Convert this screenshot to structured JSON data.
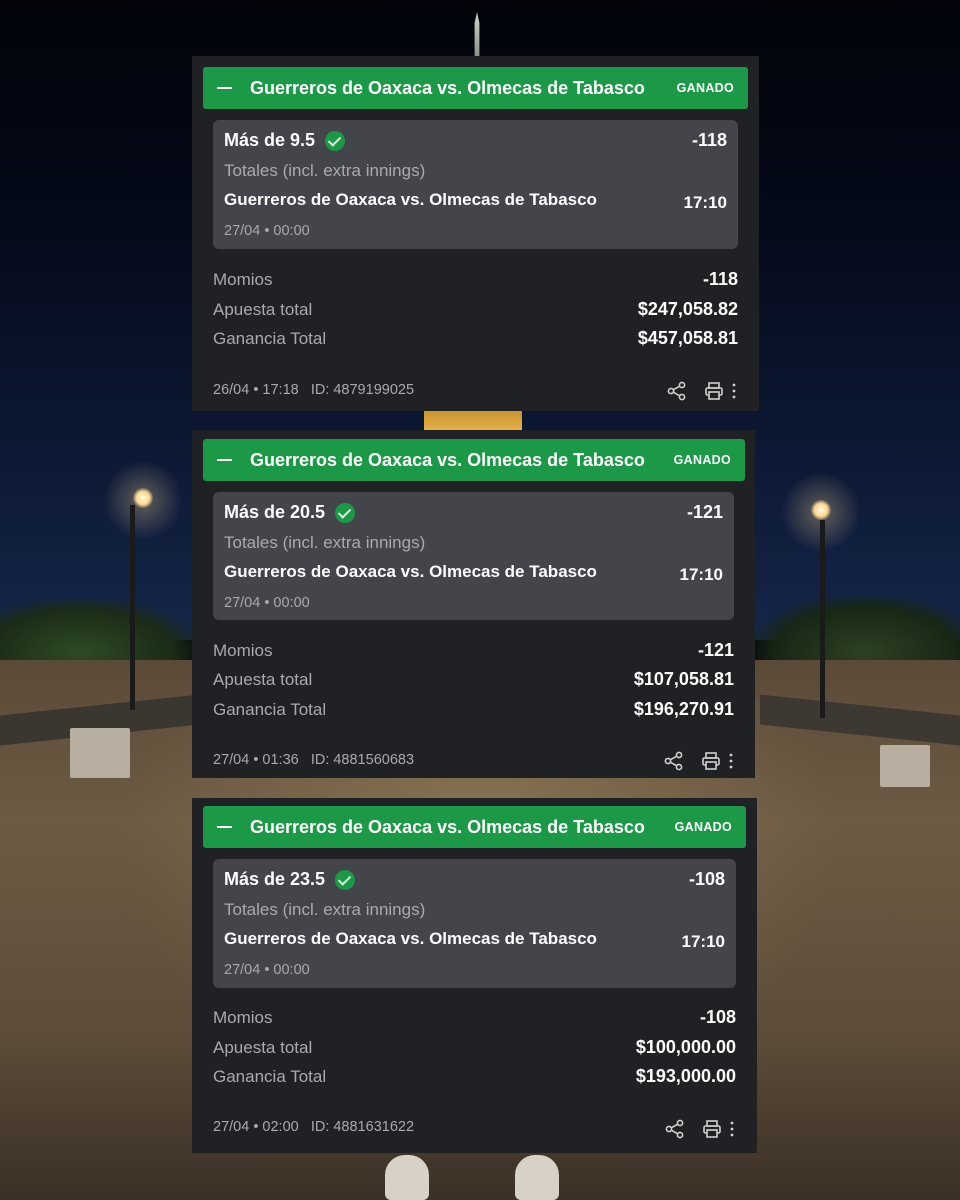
{
  "bets": [
    {
      "header_title": "Guerreros de Oaxaca vs. Olmecas de Tabasco",
      "status": "GANADO",
      "selection": "Más de 9.5",
      "selection_odds": "-118",
      "market": "Totales (incl. extra innings)",
      "event": "Guerreros de Oaxaca vs. Olmecas de Tabasco",
      "event_time": "17:10",
      "event_date": "27/04 • 00:00",
      "momios_label": "Momios",
      "momios_value": "-118",
      "stake_label": "Apuesta total",
      "stake_value": "$247,058.82",
      "payout_label": "Ganancia Total",
      "payout_value": "$457,058.81",
      "placed_at": "26/04 • 17:18",
      "bet_id": "ID: 4879199025"
    },
    {
      "header_title": "Guerreros de Oaxaca vs. Olmecas de Tabasco",
      "status": "GANADO",
      "selection": "Más de 20.5",
      "selection_odds": "-121",
      "market": "Totales (incl. extra innings)",
      "event": "Guerreros de Oaxaca vs. Olmecas de Tabasco",
      "event_time": "17:10",
      "event_date": "27/04 • 00:00",
      "momios_label": "Momios",
      "momios_value": "-121",
      "stake_label": "Apuesta total",
      "stake_value": "$107,058.81",
      "payout_label": "Ganancia Total",
      "payout_value": "$196,270.91",
      "placed_at": "27/04 • 01:36",
      "bet_id": "ID: 4881560683"
    },
    {
      "header_title": "Guerreros de Oaxaca vs. Olmecas de Tabasco",
      "status": "GANADO",
      "selection": "Más de 23.5",
      "selection_odds": "-108",
      "market": "Totales (incl. extra innings)",
      "event": "Guerreros de Oaxaca vs. Olmecas de Tabasco",
      "event_time": "17:10",
      "event_date": "27/04 • 00:00",
      "momios_label": "Momios",
      "momios_value": "-108",
      "stake_label": "Apuesta total",
      "stake_value": "$100,000.00",
      "payout_label": "Ganancia Total",
      "payout_value": "$193,000.00",
      "placed_at": "27/04 • 02:00",
      "bet_id": "ID: 4881631622"
    }
  ],
  "icons": {
    "collapse": "minus-icon",
    "won": "check-circle-icon",
    "share": "share-icon",
    "print": "printer-icon",
    "more": "more-vertical-icon"
  },
  "colors": {
    "header_green": "#1b9946",
    "card_bg": "#1f2124",
    "selection_bg": "#44454a",
    "muted_text": "#a9aaae"
  }
}
